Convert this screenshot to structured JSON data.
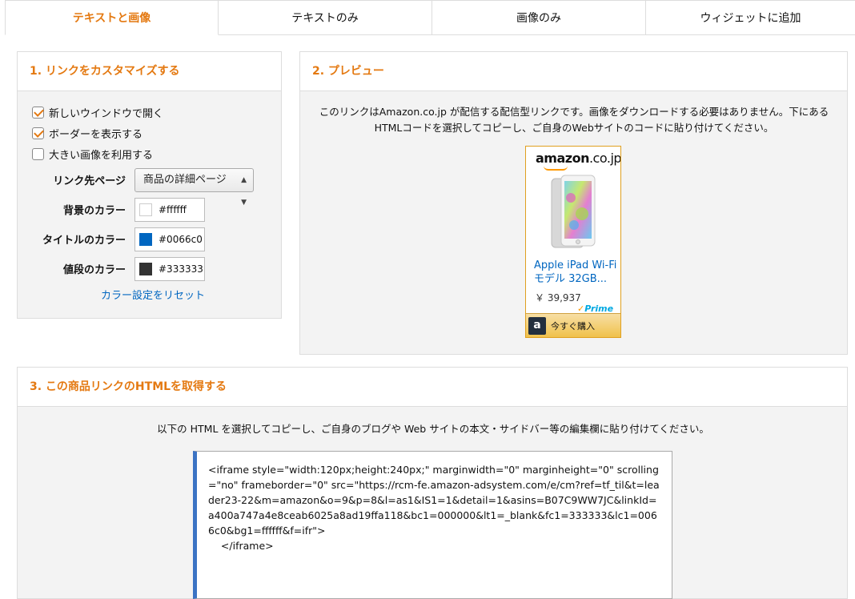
{
  "tabs": [
    {
      "label": "テキストと画像",
      "active": true
    },
    {
      "label": "テキストのみ",
      "active": false
    },
    {
      "label": "画像のみ",
      "active": false
    },
    {
      "label": "ウィジェットに追加",
      "active": false
    }
  ],
  "customize": {
    "title": "1. リンクをカスタマイズする",
    "checkboxes": [
      {
        "label": "新しいウインドウで開く",
        "checked": true
      },
      {
        "label": "ボーダーを表示する",
        "checked": true
      },
      {
        "label": "大きい画像を利用する",
        "checked": false
      }
    ],
    "link_target_label": "リンク先ページ",
    "link_target_value": "商品の詳細ページ",
    "bg_color_label": "背景のカラー",
    "bg_color_value": "#ffffff",
    "title_color_label": "タイトルのカラー",
    "title_color_value": "#0066c0",
    "price_color_label": "値段のカラー",
    "price_color_value": "#333333",
    "reset_link": "カラー設定をリセット"
  },
  "preview": {
    "title": "2. プレビュー",
    "description": "このリンクはAmazon.co.jp が配信する配信型リンクです。画像をダウンロードする必要はありません。下にあるHTMLコードを選択してコピーし、ご自身のWebサイトのコードに貼り付けてください。",
    "ad": {
      "logo_main": "amazon",
      "logo_suffix": ".co.jp",
      "product_title": "Apple iPad Wi-Fiモデル 32GB...",
      "price": "￥ 39,937",
      "prime": "Prime",
      "buy_label": "今すぐ購入"
    }
  },
  "get_html": {
    "title": "3. この商品リンクのHTMLを取得する",
    "instruction": "以下の HTML を選択してコピーし、ご自身のブログや Web サイトの本文・サイドバー等の編集欄に貼り付けてください。",
    "code": "<iframe style=\"width:120px;height:240px;\" marginwidth=\"0\" marginheight=\"0\" scrolling=\"no\" frameborder=\"0\" src=\"https://rcm-fe.amazon-adsystem.com/e/cm?ref=tf_til&t=leader23-22&m=amazon&o=9&p=8&l=as1&IS1=1&detail=1&asins=B07C9WW7JC&linkId=a400a747a4e8ceab6025a8ad19ffa118&bc1=000000&lt1=_blank&fc1=333333&lc1=0066c0&bg1=ffffff&f=ifr\">\n    </iframe>"
  },
  "colors": {
    "accent": "#e47911",
    "link": "#0066c0",
    "title_swatch": "#0066c0",
    "price_swatch": "#333333",
    "bg_swatch": "#ffffff"
  }
}
